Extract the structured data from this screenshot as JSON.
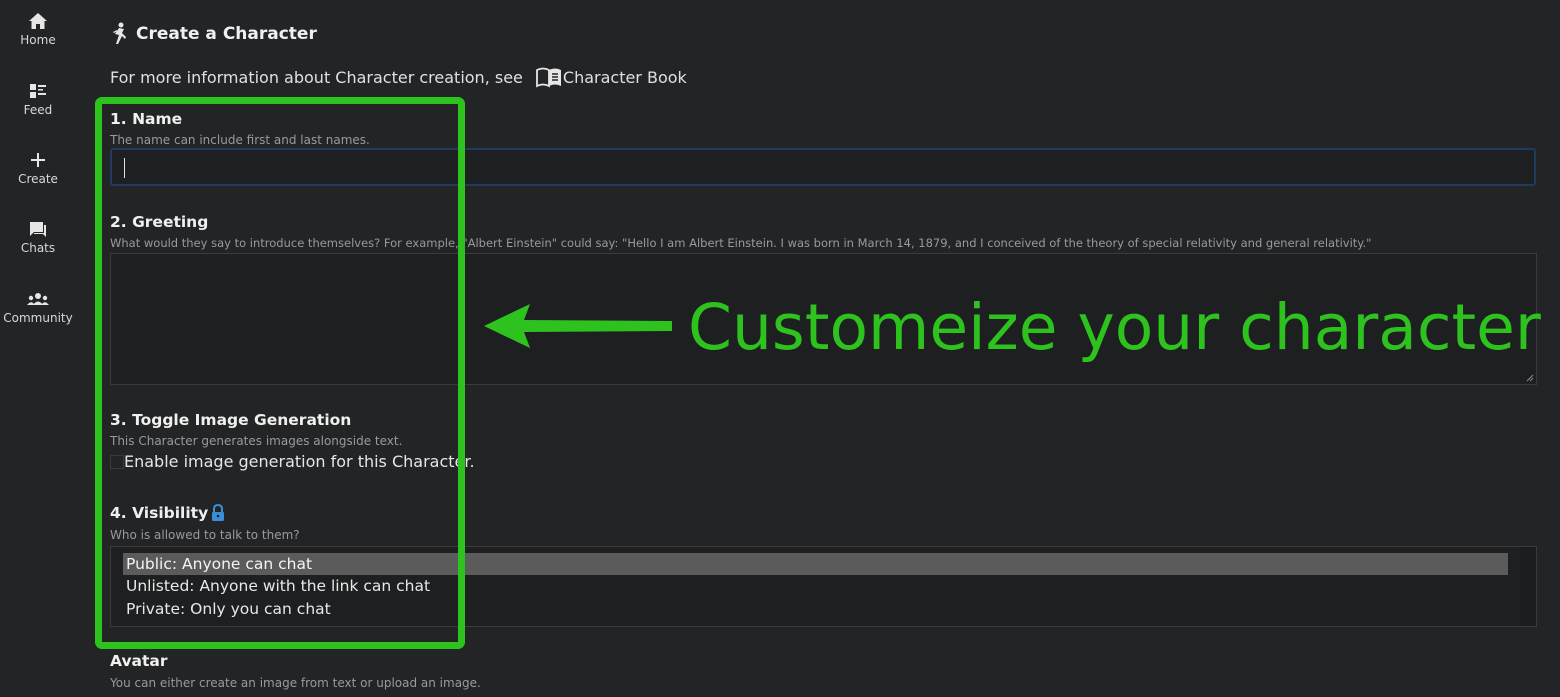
{
  "sidebar": {
    "items": [
      {
        "label": "Home",
        "icon": "home-icon"
      },
      {
        "label": "Feed",
        "icon": "feed-icon"
      },
      {
        "label": "Create",
        "icon": "plus-icon"
      },
      {
        "label": "Chats",
        "icon": "chat-icon"
      },
      {
        "label": "Community",
        "icon": "community-icon"
      }
    ]
  },
  "header": {
    "title": "Create a Character",
    "icon": "person-icon",
    "info_text": "For more information about Character creation, see",
    "book_link_label": "Character Book",
    "book_icon": "book-icon"
  },
  "form": {
    "name": {
      "title": "1. Name",
      "hint": "The name can include first and last names.",
      "value": ""
    },
    "greeting": {
      "title": "2. Greeting",
      "hint": "What would they say to introduce themselves? For example, \"Albert Einstein\" could say: \"Hello I am Albert Einstein. I was born in March 14, 1879, and I conceived of the theory of special relativity and general relativity.\"",
      "value": ""
    },
    "image_generation": {
      "title": "3. Toggle Image Generation",
      "hint": "This Character generates images alongside text.",
      "checkbox_label": "Enable image generation for this Character.",
      "checked": false
    },
    "visibility": {
      "title": "4. Visibility",
      "lock_icon": "lock-icon",
      "hint": "Who is allowed to talk to them?",
      "options": [
        "Public: Anyone can chat",
        "Unlisted: Anyone with the link can chat",
        "Private: Only you can chat"
      ],
      "selected": "Public: Anyone can chat"
    },
    "avatar": {
      "title": "Avatar",
      "hint": "You can either create an image from text or upload an image."
    }
  },
  "annotation": {
    "text": "Customeize your character",
    "color": "#2ec21f"
  },
  "colors": {
    "background": "#232425",
    "selected_option": "#5b5b5b",
    "lock_blue": "#3a8fd9",
    "focus_border": "#223a5e"
  }
}
